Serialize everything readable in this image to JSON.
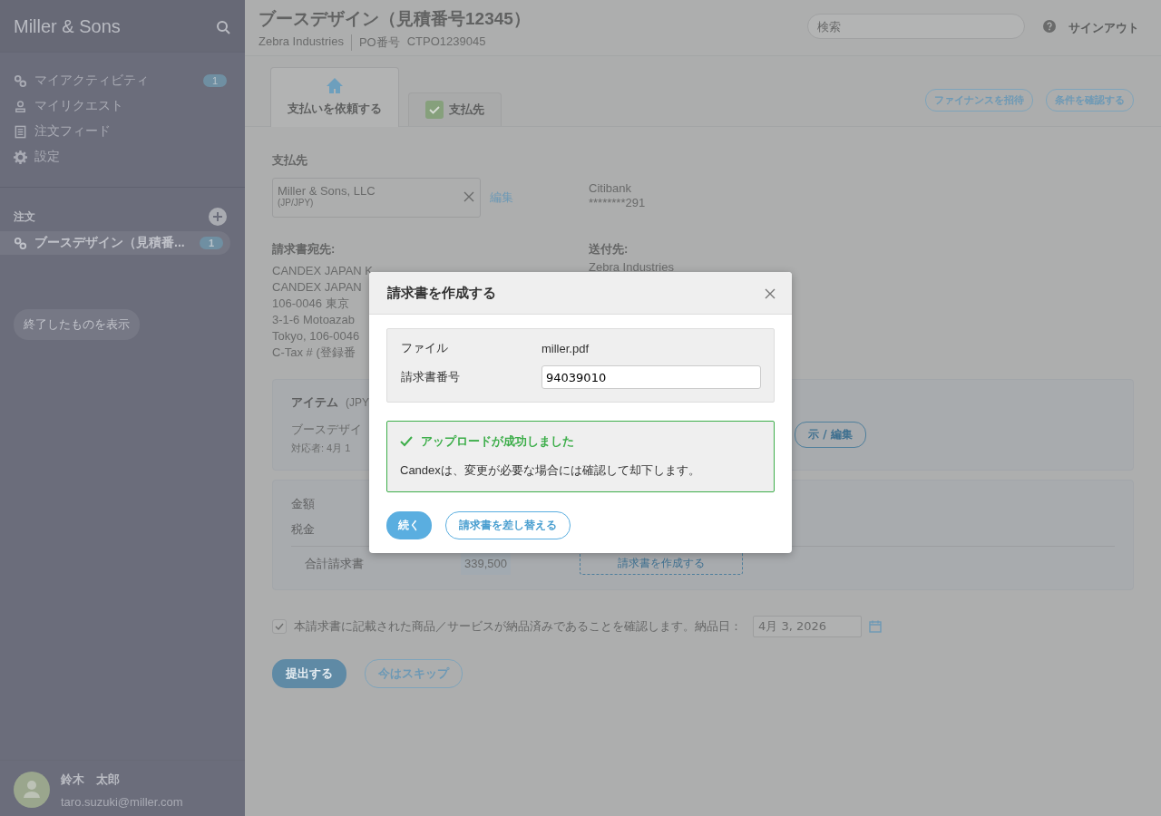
{
  "sidebar": {
    "brand": "Miller & Sons",
    "nav": [
      {
        "kind": "link",
        "label": "マイアクティビティ",
        "badge": "1"
      },
      {
        "kind": "user",
        "label": "マイリクエスト"
      },
      {
        "kind": "list",
        "label": "注文フィード"
      },
      {
        "kind": "gear",
        "label": "設定"
      }
    ],
    "section_title": "注文",
    "orders": [
      {
        "label": "ブースデザイン（見積番...",
        "badge": "1",
        "selected": true
      }
    ],
    "show_closed_button": "終了したものを表示",
    "user": {
      "name": "鈴木　太郎",
      "email": "taro.suzuki@miller.com"
    }
  },
  "header": {
    "title": "ブースデザイン（見積番号12345）",
    "company": "Zebra Industries",
    "po_label": "PO番号",
    "po_number": "CTPO1239045",
    "search": {
      "placeholder": "検索"
    },
    "sign_out": "サインアウト"
  },
  "tabs": [
    {
      "kind": "home",
      "label": "支払いを依頼する",
      "selected": true
    },
    {
      "kind": "check",
      "label": "支払先",
      "selected": false
    }
  ],
  "action_buttons": [
    "ファイナンスを招待",
    "条件を確認する"
  ],
  "payee": {
    "label": "支払先",
    "vendor_name": "Miller & Sons, LLC",
    "vendor_region": "(JP/JPY)",
    "edit_link": "編集",
    "bank_name": "Citibank",
    "account": "********291"
  },
  "bill_to": {
    "label": "請求書宛先:",
    "lines": [
      "CANDEX JAPAN K",
      "CANDEX JAPAN",
      "106-0046 東京",
      "3-1-6 Motoazab",
      "Tokyo, 106-0046",
      "C-Tax # (登録番"
    ]
  },
  "ship_to": {
    "label": "送付先:",
    "lines": [
      "Zebra Industries"
    ]
  },
  "items": {
    "title": "アイテム",
    "currency": "(JPY",
    "item_name": "ブースデザイ",
    "meta": "対応者: 4月 1",
    "view_edit_button": "示 / 編集"
  },
  "totals": {
    "rows": [
      "金額",
      "税金"
    ],
    "total_label": "合計請求書",
    "total_value": "339,500",
    "create_invoice_button": "請求書を作成する"
  },
  "confirmation": {
    "checked": true,
    "text": "本請求書に記載された商品／サービスが納品済みであることを確認します。納品日：",
    "date_value": "4月 3, 2026"
  },
  "footer_buttons": {
    "submit": "提出する",
    "skip": "今はスキップ"
  },
  "modal": {
    "title": "請求書を作成する",
    "file_label": "ファイル",
    "file_name": "miller.pdf",
    "number_label": "請求書番号",
    "number_value": "94039010",
    "success": {
      "title": "アップロードが成功しました",
      "message": "Candexは、変更が必要な場合には確認して却下します。"
    },
    "continue_button": "続く",
    "replace_button": "請求書を差し替える"
  }
}
